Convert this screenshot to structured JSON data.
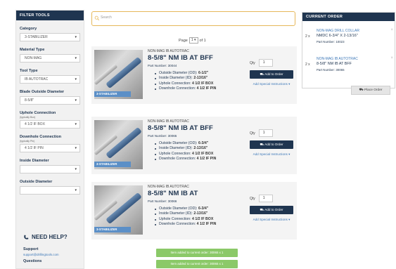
{
  "filter": {
    "title": "FILTER TOOLS",
    "fields": [
      {
        "label": "Category",
        "value": "3-STABILIZER"
      },
      {
        "label": "Material Type",
        "value": "NON-MAG"
      },
      {
        "label": "Tool Type",
        "value": "IB AUTOTRAC"
      },
      {
        "label": "Blade Outside Diameter",
        "value": "8-5/8\""
      },
      {
        "label": "Uphole Connection",
        "sublabel": "(typically Box)",
        "value": "4 1/2 IF BOX"
      },
      {
        "label": "Downhole Connection",
        "sublabel": "(typically Pin)",
        "value": "4 1/2 IF PIN"
      },
      {
        "label": "Inside Diameter",
        "value": ""
      },
      {
        "label": "Outside Diameter",
        "value": ""
      }
    ],
    "help": {
      "title": "NEED HELP?",
      "support_label": "Support",
      "support_email": "support@drillingtools.com",
      "cut_label": "Questions"
    }
  },
  "search": {
    "placeholder": "Search"
  },
  "pager": {
    "prefix": "Page",
    "current": "1",
    "suffix": "of 1"
  },
  "products": [
    {
      "badge": "3-STABILIZER",
      "category": "NON-MAG IB AUTOTRAC",
      "name": "8-5/8\" NM IB AT BFF",
      "part_number": "Part Number: 30044",
      "specs": [
        {
          "k": "Outside Diameter (OD):",
          "v": "6-1/2\""
        },
        {
          "k": "Inside Diameter (ID):",
          "v": "2-13/16\""
        },
        {
          "k": "Uphole Connection:",
          "v": "4 1/2 IF BOX"
        },
        {
          "k": "Downhole Connection:",
          "v": "4 1/2 IF PIN"
        }
      ],
      "qty_label": "Qty",
      "qty": "1",
      "add_label": "Add to Order",
      "special_link": "Add Special Instructions ▾"
    },
    {
      "badge": "3-STABILIZER",
      "category": "NON-MAG IB AUTOTRAC",
      "name": "8-5/8\" NM IB AT BFF",
      "part_number": "Part Number: 30065",
      "specs": [
        {
          "k": "Outside Diameter (OD):",
          "v": "6-3/4\""
        },
        {
          "k": "Inside Diameter (ID):",
          "v": "2-13/16\""
        },
        {
          "k": "Uphole Connection:",
          "v": "4 1/2 IF BOX"
        },
        {
          "k": "Downhole Connection:",
          "v": "4 1/2 IF PIN"
        }
      ],
      "qty_label": "Qty",
      "qty": "1",
      "add_label": "Add to Order",
      "special_link": "Add Special Instructions ▾"
    },
    {
      "badge": "3-STABILIZER",
      "category": "NON-MAG IB AUTOTRAC",
      "name": "8-5/8\" NM IB AT",
      "part_number": "Part Number: 30066",
      "specs": [
        {
          "k": "Outside Diameter (OD):",
          "v": "6-3/4\""
        },
        {
          "k": "Inside Diameter (ID):",
          "v": "2-13/16\""
        },
        {
          "k": "Uphole Connection:",
          "v": "4 1/2 IF BOX"
        },
        {
          "k": "Downhole Connection:",
          "v": "4 1/2 IF PIN"
        }
      ],
      "qty_label": "Qty",
      "qty": "1",
      "add_label": "Add to Order",
      "special_link": "Add Special Instructions ▾"
    }
  ],
  "notices": [
    "Item added to current order: 30065 x 1",
    "Item added to current order: 30065 x 1"
  ],
  "order": {
    "title": "CURRENT ORDER",
    "items": [
      {
        "qty": "2 x",
        "category": "NON-MAG DRILL COLLAR",
        "name": "NMDC 6-3/4\" X 2-13/16\"",
        "part_number": "Part Number: 10023"
      },
      {
        "qty": "2 x",
        "category": "NON-MAG IB AUTOTRAC",
        "name": "8-5/8\" NM IB AT BFF",
        "part_number": "Part Number: 30065"
      }
    ],
    "place_label": "Place Order"
  },
  "colors": {
    "navy": "#1f3550",
    "link": "#3d78b8",
    "success": "#8bc968",
    "search_border": "#e6b85a"
  }
}
